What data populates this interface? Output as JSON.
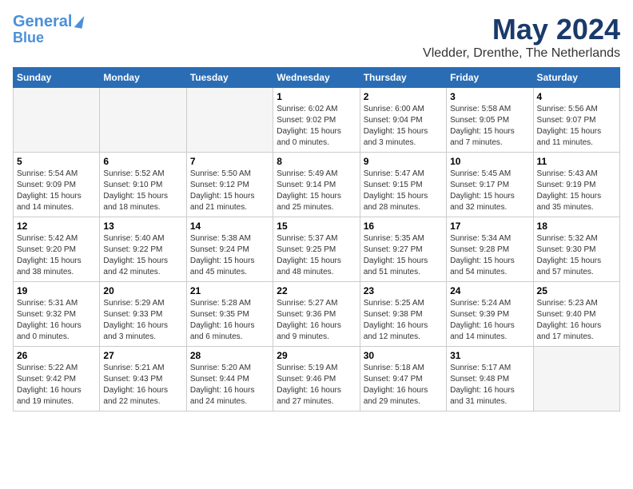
{
  "header": {
    "logo_line1": "General",
    "logo_line2": "Blue",
    "month_title": "May 2024",
    "location": "Vledder, Drenthe, The Netherlands"
  },
  "days_of_week": [
    "Sunday",
    "Monday",
    "Tuesday",
    "Wednesday",
    "Thursday",
    "Friday",
    "Saturday"
  ],
  "weeks": [
    [
      {
        "day": "",
        "info": ""
      },
      {
        "day": "",
        "info": ""
      },
      {
        "day": "",
        "info": ""
      },
      {
        "day": "1",
        "info": "Sunrise: 6:02 AM\nSunset: 9:02 PM\nDaylight: 15 hours\nand 0 minutes."
      },
      {
        "day": "2",
        "info": "Sunrise: 6:00 AM\nSunset: 9:04 PM\nDaylight: 15 hours\nand 3 minutes."
      },
      {
        "day": "3",
        "info": "Sunrise: 5:58 AM\nSunset: 9:05 PM\nDaylight: 15 hours\nand 7 minutes."
      },
      {
        "day": "4",
        "info": "Sunrise: 5:56 AM\nSunset: 9:07 PM\nDaylight: 15 hours\nand 11 minutes."
      }
    ],
    [
      {
        "day": "5",
        "info": "Sunrise: 5:54 AM\nSunset: 9:09 PM\nDaylight: 15 hours\nand 14 minutes."
      },
      {
        "day": "6",
        "info": "Sunrise: 5:52 AM\nSunset: 9:10 PM\nDaylight: 15 hours\nand 18 minutes."
      },
      {
        "day": "7",
        "info": "Sunrise: 5:50 AM\nSunset: 9:12 PM\nDaylight: 15 hours\nand 21 minutes."
      },
      {
        "day": "8",
        "info": "Sunrise: 5:49 AM\nSunset: 9:14 PM\nDaylight: 15 hours\nand 25 minutes."
      },
      {
        "day": "9",
        "info": "Sunrise: 5:47 AM\nSunset: 9:15 PM\nDaylight: 15 hours\nand 28 minutes."
      },
      {
        "day": "10",
        "info": "Sunrise: 5:45 AM\nSunset: 9:17 PM\nDaylight: 15 hours\nand 32 minutes."
      },
      {
        "day": "11",
        "info": "Sunrise: 5:43 AM\nSunset: 9:19 PM\nDaylight: 15 hours\nand 35 minutes."
      }
    ],
    [
      {
        "day": "12",
        "info": "Sunrise: 5:42 AM\nSunset: 9:20 PM\nDaylight: 15 hours\nand 38 minutes."
      },
      {
        "day": "13",
        "info": "Sunrise: 5:40 AM\nSunset: 9:22 PM\nDaylight: 15 hours\nand 42 minutes."
      },
      {
        "day": "14",
        "info": "Sunrise: 5:38 AM\nSunset: 9:24 PM\nDaylight: 15 hours\nand 45 minutes."
      },
      {
        "day": "15",
        "info": "Sunrise: 5:37 AM\nSunset: 9:25 PM\nDaylight: 15 hours\nand 48 minutes."
      },
      {
        "day": "16",
        "info": "Sunrise: 5:35 AM\nSunset: 9:27 PM\nDaylight: 15 hours\nand 51 minutes."
      },
      {
        "day": "17",
        "info": "Sunrise: 5:34 AM\nSunset: 9:28 PM\nDaylight: 15 hours\nand 54 minutes."
      },
      {
        "day": "18",
        "info": "Sunrise: 5:32 AM\nSunset: 9:30 PM\nDaylight: 15 hours\nand 57 minutes."
      }
    ],
    [
      {
        "day": "19",
        "info": "Sunrise: 5:31 AM\nSunset: 9:32 PM\nDaylight: 16 hours\nand 0 minutes."
      },
      {
        "day": "20",
        "info": "Sunrise: 5:29 AM\nSunset: 9:33 PM\nDaylight: 16 hours\nand 3 minutes."
      },
      {
        "day": "21",
        "info": "Sunrise: 5:28 AM\nSunset: 9:35 PM\nDaylight: 16 hours\nand 6 minutes."
      },
      {
        "day": "22",
        "info": "Sunrise: 5:27 AM\nSunset: 9:36 PM\nDaylight: 16 hours\nand 9 minutes."
      },
      {
        "day": "23",
        "info": "Sunrise: 5:25 AM\nSunset: 9:38 PM\nDaylight: 16 hours\nand 12 minutes."
      },
      {
        "day": "24",
        "info": "Sunrise: 5:24 AM\nSunset: 9:39 PM\nDaylight: 16 hours\nand 14 minutes."
      },
      {
        "day": "25",
        "info": "Sunrise: 5:23 AM\nSunset: 9:40 PM\nDaylight: 16 hours\nand 17 minutes."
      }
    ],
    [
      {
        "day": "26",
        "info": "Sunrise: 5:22 AM\nSunset: 9:42 PM\nDaylight: 16 hours\nand 19 minutes."
      },
      {
        "day": "27",
        "info": "Sunrise: 5:21 AM\nSunset: 9:43 PM\nDaylight: 16 hours\nand 22 minutes."
      },
      {
        "day": "28",
        "info": "Sunrise: 5:20 AM\nSunset: 9:44 PM\nDaylight: 16 hours\nand 24 minutes."
      },
      {
        "day": "29",
        "info": "Sunrise: 5:19 AM\nSunset: 9:46 PM\nDaylight: 16 hours\nand 27 minutes."
      },
      {
        "day": "30",
        "info": "Sunrise: 5:18 AM\nSunset: 9:47 PM\nDaylight: 16 hours\nand 29 minutes."
      },
      {
        "day": "31",
        "info": "Sunrise: 5:17 AM\nSunset: 9:48 PM\nDaylight: 16 hours\nand 31 minutes."
      },
      {
        "day": "",
        "info": ""
      }
    ]
  ]
}
